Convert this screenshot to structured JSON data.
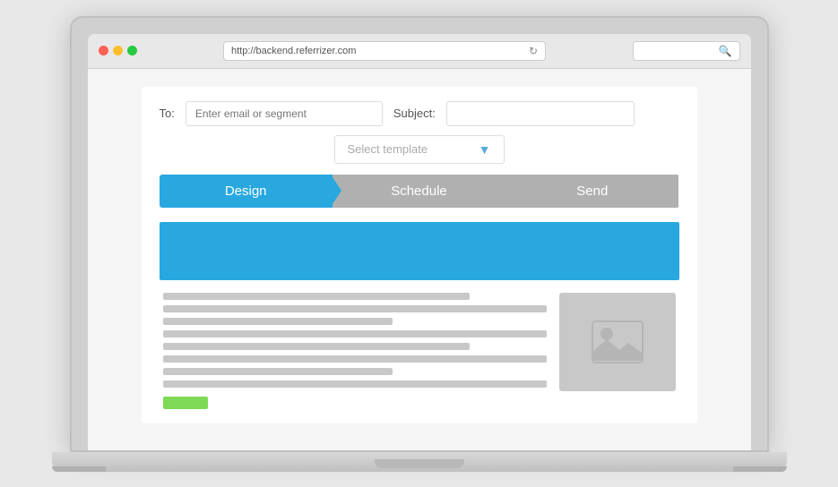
{
  "browser": {
    "url": "http://backend.referrizer.com",
    "search_placeholder": ""
  },
  "form": {
    "to_label": "To:",
    "to_placeholder": "Enter email or segment",
    "subject_label": "Subject:",
    "subject_value": ""
  },
  "template_select": {
    "label": "Select template",
    "chevron": "▼"
  },
  "steps": [
    {
      "label": "Design",
      "state": "active"
    },
    {
      "label": "Schedule",
      "state": "inactive"
    },
    {
      "label": "Send",
      "state": "inactive"
    }
  ],
  "colors": {
    "active_step": "#29a8e0",
    "inactive_step": "#b0b0b0",
    "header_banner": "#29a8e0",
    "green_button": "#7ed957",
    "placeholder_gray": "#c8c8c8"
  }
}
